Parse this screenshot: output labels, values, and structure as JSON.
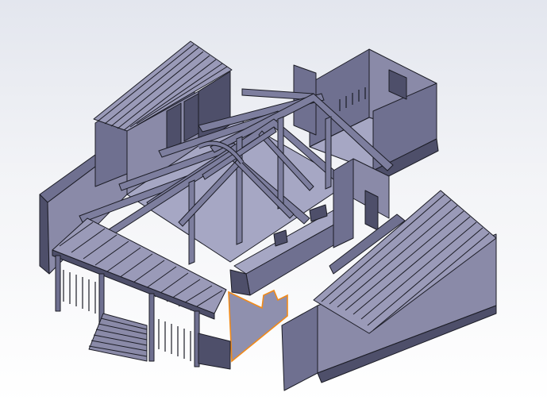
{
  "app": {
    "name": "",
    "view": "isometric"
  },
  "model": {
    "selected_face_color": "#f08a1a",
    "body_color": "#6f7090",
    "background_top": "#e3e6ee",
    "background_bottom": "#ffffff",
    "parts": [
      "left-cabin-roof",
      "back-room",
      "timber-truss-frame",
      "front-porch",
      "right-shed-roof",
      "interior-partition-selected"
    ]
  }
}
